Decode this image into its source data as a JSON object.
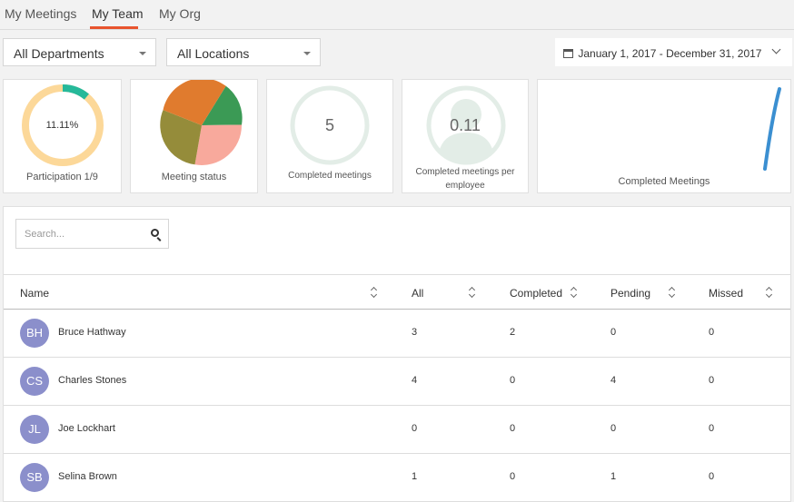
{
  "tabs": [
    {
      "label": "My Meetings"
    },
    {
      "label": "My Team"
    },
    {
      "label": "My Org"
    }
  ],
  "filters": {
    "department": "All Departments",
    "location": "All Locations",
    "date_range": "January 1, 2017 - December 31, 2017"
  },
  "cards": {
    "participation": {
      "value": "11.11%",
      "label": "Participation 1/9",
      "fraction": 0.1111,
      "colors": {
        "track": "#fcd899",
        "fill": "#26b99a"
      }
    },
    "meeting_status": {
      "label": "Meeting status"
    },
    "completed": {
      "value": "5",
      "label": "Completed meetings"
    },
    "per_employee": {
      "value": "0.11",
      "label_line1": "Completed meetings per",
      "label_line2": "employee"
    },
    "trend": {
      "label": "Completed Meetings",
      "color": "#3b8fd1"
    }
  },
  "search": {
    "placeholder": "Search..."
  },
  "table": {
    "columns": [
      "Name",
      "All",
      "Completed",
      "Pending",
      "Missed"
    ],
    "rows": [
      {
        "initials": "BH",
        "name": "Bruce Hathway",
        "all": "3",
        "completed": "2",
        "pending": "0",
        "missed": "0"
      },
      {
        "initials": "CS",
        "name": "Charles Stones",
        "all": "4",
        "completed": "0",
        "pending": "4",
        "missed": "0"
      },
      {
        "initials": "JL",
        "name": "Joe Lockhart",
        "all": "0",
        "completed": "0",
        "pending": "0",
        "missed": "0"
      },
      {
        "initials": "SB",
        "name": "Selina Brown",
        "all": "1",
        "completed": "0",
        "pending": "1",
        "missed": "0"
      }
    ]
  },
  "colors": {
    "accent": "#e8542e",
    "avatar": "#8b8fcb"
  }
}
